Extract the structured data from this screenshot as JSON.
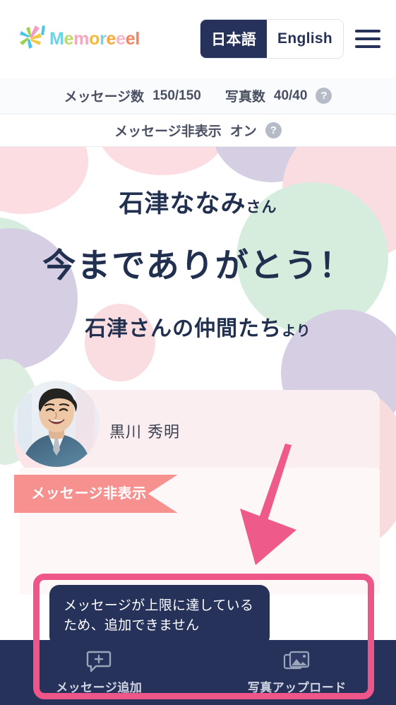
{
  "header": {
    "brand_text": "Memoreeel",
    "brand_letters": [
      "M",
      "e",
      "m",
      "o",
      "r",
      "e",
      "e",
      "e",
      "l"
    ],
    "logo_icon": "confetti-burst-icon",
    "lang_ja": "日本語",
    "lang_en": "English",
    "menu_icon": "hamburger-menu-icon",
    "accent_navy": "#26325a"
  },
  "stats": {
    "message_label": "メッセージ数",
    "message_count": "150/150",
    "photo_label": "写真数",
    "photo_count": "40/40",
    "help_icon": "?",
    "hide_label": "メッセージ非表示",
    "hide_state": "オン"
  },
  "hero": {
    "recipient_name": "石津ななみ",
    "recipient_honorific": "さん",
    "main_message": "今までありがとう！",
    "from_text": "石津さんの仲間たち",
    "from_suffix": "より",
    "text_color": "#22304f"
  },
  "message_card": {
    "author_name": "黒川 秀明",
    "avatar_icon": "user-portrait-photo",
    "ribbon_label": "メッセージ非表示",
    "ribbon_color": "#f7918f",
    "card_bg": "#fbeef1"
  },
  "annotation": {
    "arrow_icon": "pink-down-arrow",
    "arrow_color": "#ee5a8a",
    "highlight_color": "#ee5588"
  },
  "tooltip": {
    "text": "メッセージが上限に達しているため、追加できません"
  },
  "bottom_nav": {
    "items": [
      {
        "label": "メッセージ追加",
        "icon": "message-plus-icon"
      },
      {
        "label": "写真アップロード",
        "icon": "photo-stack-icon"
      }
    ],
    "bg_color": "#26325a"
  },
  "background_blobs": {
    "pink": "#fbdde2",
    "lavender": "#d6cfe4",
    "mint": "#d6ecdc",
    "rose": "#f9dde1"
  }
}
